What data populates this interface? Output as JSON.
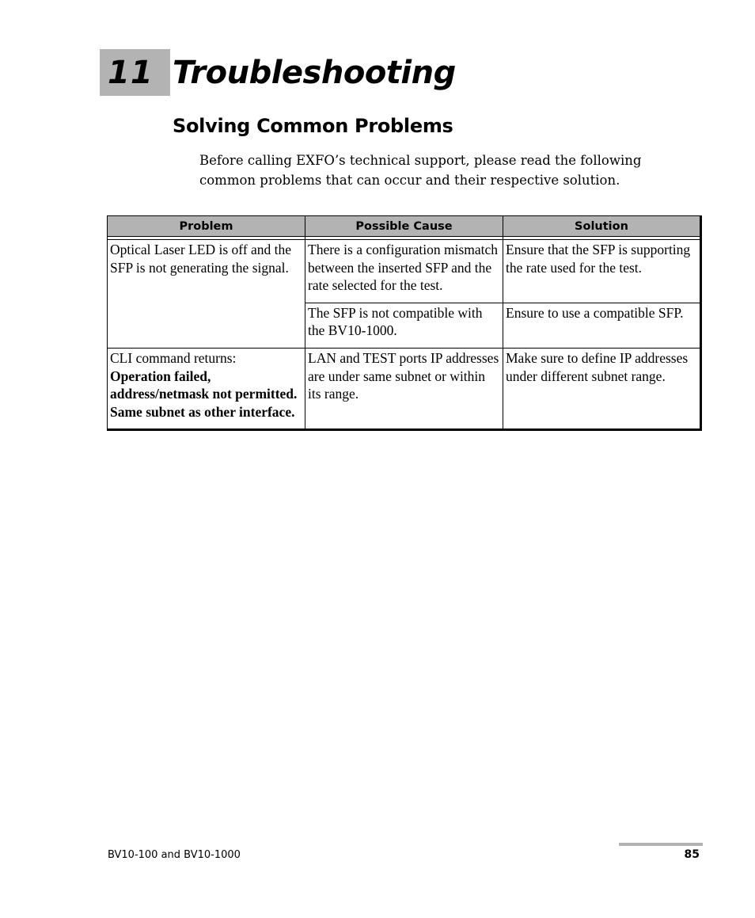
{
  "chapter": {
    "number": "11",
    "title": "Troubleshooting"
  },
  "section": {
    "title": "Solving Common Problems",
    "intro": "Before calling EXFO’s technical support, please read the following common problems that can occur and their respective solution."
  },
  "table": {
    "headers": [
      "Problem",
      "Possible Cause",
      "Solution"
    ],
    "rows": [
      {
        "problem": "Optical Laser LED is off and the SFP is not generating the signal.",
        "causes": [
          {
            "cause": "There is a configuration mismatch between the inserted SFP and the rate selected for the test.",
            "solution": "Ensure that the SFP is supporting the rate used for the test."
          },
          {
            "cause": "The SFP is not compatible with the BV10-1000.",
            "solution": "Ensure to use a compatible SFP."
          }
        ]
      },
      {
        "problem_prefix": "CLI command returns:",
        "problem_bold": "Operation failed, address/netmask not permitted. Same subnet as other interface.",
        "causes": [
          {
            "cause": "LAN and TEST ports IP addresses are under same subnet or within its range.",
            "solution": "Make sure to define IP addresses under different subnet range."
          }
        ]
      }
    ]
  },
  "footer": {
    "product": "BV10-100 and BV10-1000",
    "page_number": "85"
  }
}
